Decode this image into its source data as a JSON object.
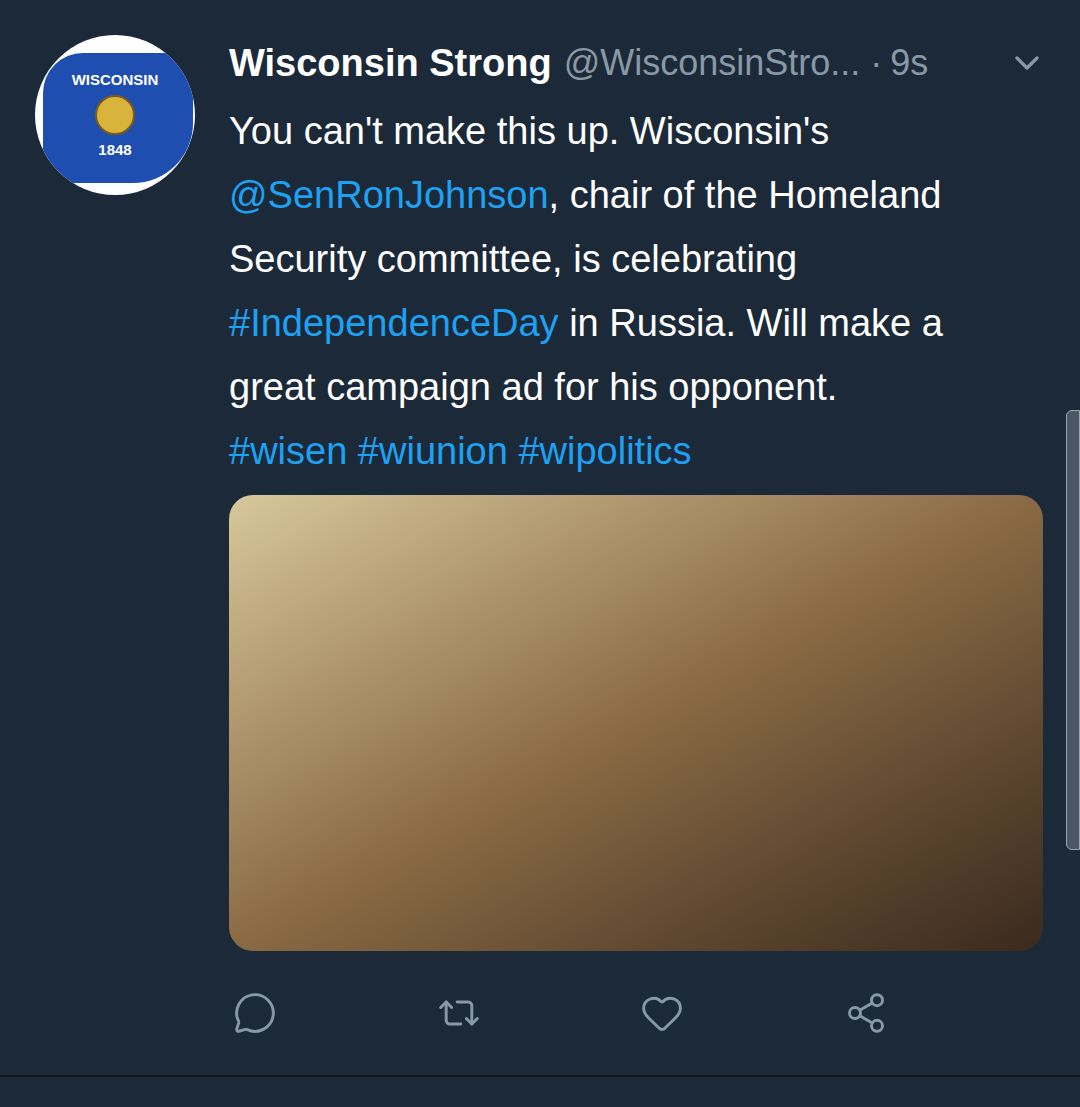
{
  "avatar": {
    "top_text": "WISCONSIN",
    "bottom_text": "1848"
  },
  "author": {
    "name": "Wisconsin Strong",
    "handle": "@WisconsinStro...",
    "separator": "·",
    "time": "9s"
  },
  "tweet": {
    "lines": [
      [
        {
          "text": "You can't make this up. Wisconsin's",
          "kind": "plain"
        }
      ],
      [
        {
          "text": "@SenRonJohnson",
          "kind": "link"
        },
        {
          "text": ", chair of the Homeland",
          "kind": "plain"
        }
      ],
      [
        {
          "text": "Security committee, is celebrating",
          "kind": "plain"
        }
      ],
      [
        {
          "text": "#IndependenceDay",
          "kind": "link"
        },
        {
          "text": " in Russia. Will make a",
          "kind": "plain"
        }
      ],
      [
        {
          "text": "great campaign ad for his opponent.",
          "kind": "plain"
        }
      ],
      [
        {
          "text": "#wisen",
          "kind": "link"
        },
        {
          "text": " ",
          "kind": "plain"
        },
        {
          "text": "#wiunion",
          "kind": "link"
        },
        {
          "text": " ",
          "kind": "plain"
        },
        {
          "text": "#wipolitics",
          "kind": "link"
        }
      ]
    ]
  }
}
